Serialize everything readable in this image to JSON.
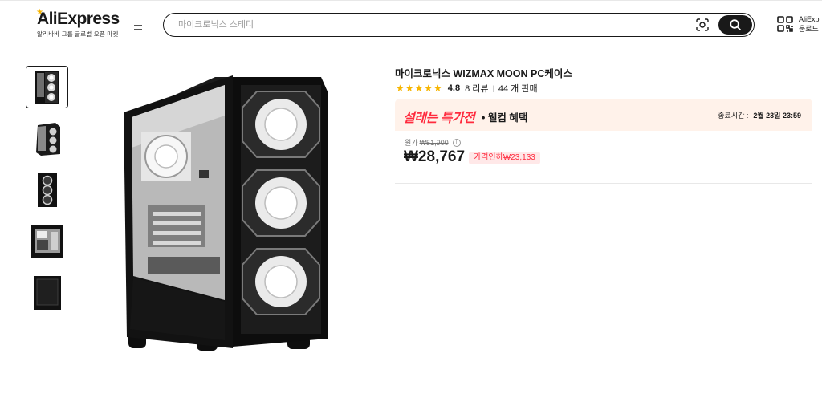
{
  "header": {
    "logo_text": "AliExpress",
    "logo_sub": "알리바바 그룹 글로벌 오픈 마켓",
    "search_placeholder": "마이크로닉스 스테디",
    "app_download_line1": "AliExp",
    "app_download_line2": "운로드"
  },
  "product": {
    "title": "마이크로닉스 WIZMAX MOON PC케이스",
    "stars": "★★★★★",
    "rating": "4.8",
    "reviews": "8 리뷰",
    "rating_sep": "|",
    "sold": "44 개 판매",
    "thumbnails_count": 5
  },
  "promo": {
    "badge": "설레는 특가전",
    "subtitle": "• 웰컴 혜택",
    "end_label": "종료시간 :",
    "end_time": "2월 23일 23:59"
  },
  "price": {
    "original_label": "원가",
    "original_price": "₩51,900",
    "info_icon": "i",
    "sale_price": "₩28,767",
    "discount_text": "가격인하₩23,133"
  },
  "colors": {
    "accent_red": "#ff2b3e",
    "promo_bg": "#fff2ea",
    "star_yellow": "#f7b500",
    "dark": "#191919"
  }
}
